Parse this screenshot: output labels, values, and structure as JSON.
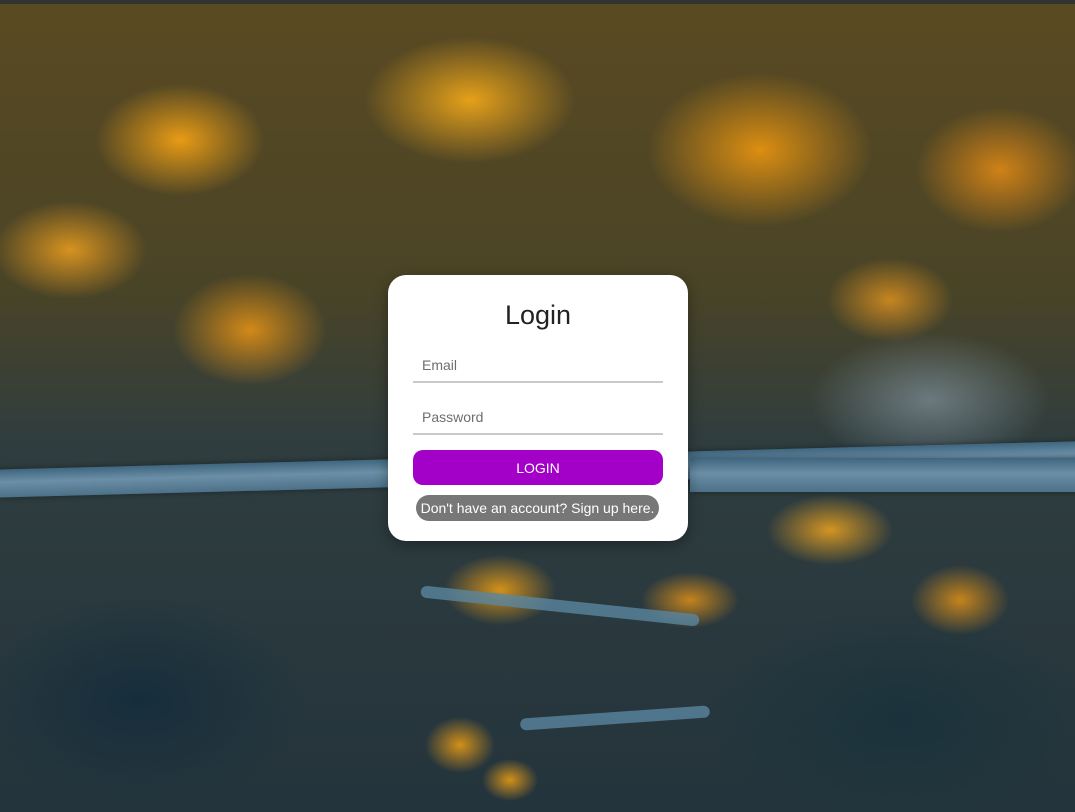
{
  "login": {
    "title": "Login",
    "email_placeholder": "Email",
    "password_placeholder": "Password",
    "login_button": "LOGIN",
    "signup_link": "Don't have an account? Sign up here."
  },
  "colors": {
    "accent": "#a300c8",
    "link_background": "#777777",
    "card_background": "#ffffff"
  }
}
